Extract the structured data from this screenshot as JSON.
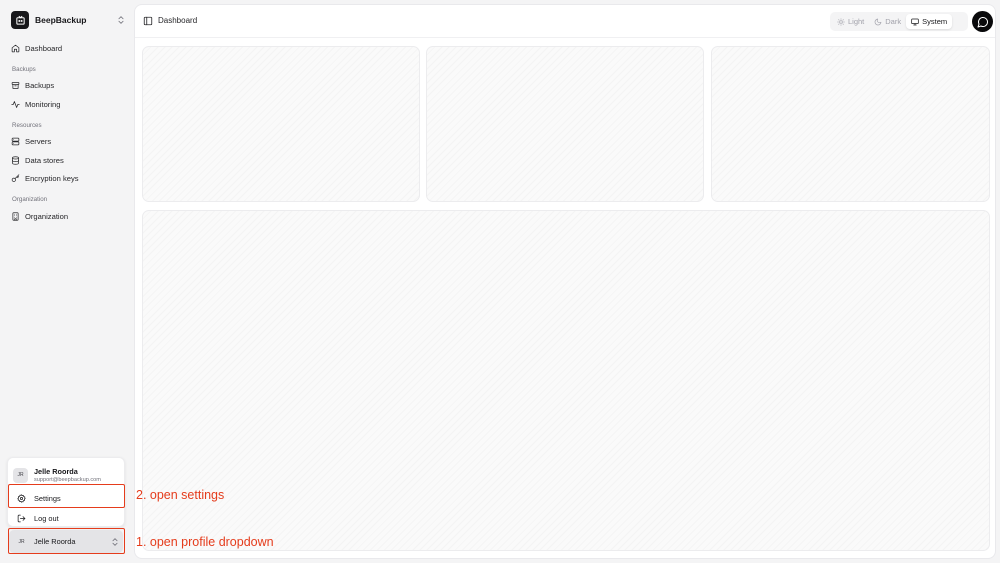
{
  "app": {
    "name": "BeepBackup"
  },
  "nav": {
    "dashboard": "Dashboard",
    "groups": {
      "backups": "Backups",
      "resources": "Resources",
      "organization": "Organization"
    },
    "items": {
      "backups": "Backups",
      "monitoring": "Monitoring",
      "servers": "Servers",
      "data_stores": "Data stores",
      "encryption_keys": "Encryption keys",
      "organization": "Organization"
    }
  },
  "profile_menu": {
    "initials": "JR",
    "name": "Jelle Roorda",
    "email": "support@beepbackup.com",
    "settings": "Settings",
    "logout": "Log out"
  },
  "profile_trigger": {
    "initials": "JR",
    "name": "Jelle Roorda"
  },
  "header": {
    "title": "Dashboard"
  },
  "theme": {
    "light": "Light",
    "dark": "Dark",
    "system": "System",
    "selected": "System"
  },
  "annotations": {
    "step1": "1. open profile dropdown",
    "step2": "2. open settings",
    "color": "#e53c1c"
  }
}
